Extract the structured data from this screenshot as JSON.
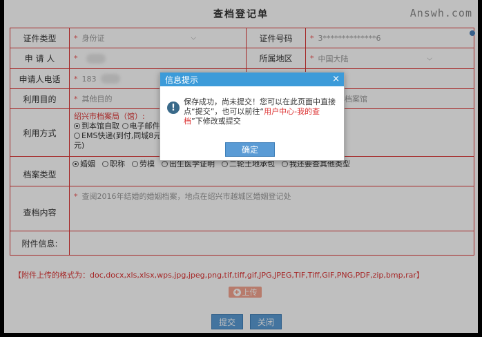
{
  "page": {
    "title": "查档登记单",
    "watermark": "Answh.com"
  },
  "form": {
    "id_type_label": "证件类型",
    "id_type_value": "身份证",
    "id_no_label": "证件号码",
    "id_no_value": "3**************6",
    "applicant_label": "申 请 人",
    "region_label": "所属地区",
    "region_value": "中国大陆",
    "phone_label": "申请人电话",
    "phone_value": "183",
    "purpose_label": "利用目的",
    "purpose_value": "其他目的",
    "archive_value": "档案馆",
    "method_label": "利用方式",
    "method_org": "绍兴市档案局（馆）:",
    "method_opt1": "到本馆自取",
    "method_opt2": "电子邮件",
    "method_opt3": "EMS快递(到付,同城8元",
    "method_opt3b": "元)",
    "type_label": "档案类型",
    "types": [
      "婚姻",
      "职称",
      "劳模",
      "出生医学证明",
      "二轮土地承包",
      "我还要查其他类型"
    ],
    "content_label": "查档内容",
    "content_value": "查阅2016年结婚的婚姻档案，地点在绍兴市越城区婚姻登记处",
    "attach_label": "附件信息:",
    "star": "*"
  },
  "formats": "【附件上传的格式为：doc,docx,xls,xlsx,wps,jpg,jpeg,png,tif,tiff,gif,JPG,JPEG,TIF,Tiff,GIF,PNG,PDF,zip,bmp,rar】",
  "upload_label": "上传",
  "submit_label": "提交",
  "close_label": "关闭",
  "modal": {
    "title": "信息提示",
    "close": "×",
    "msg_a": "保存成功，尚未提交！您可以在此页面中直接点“提交”，也可以前往“",
    "msg_link": "用户中心-我的查档",
    "msg_b": "”下修改或提交",
    "ok": "确定"
  }
}
